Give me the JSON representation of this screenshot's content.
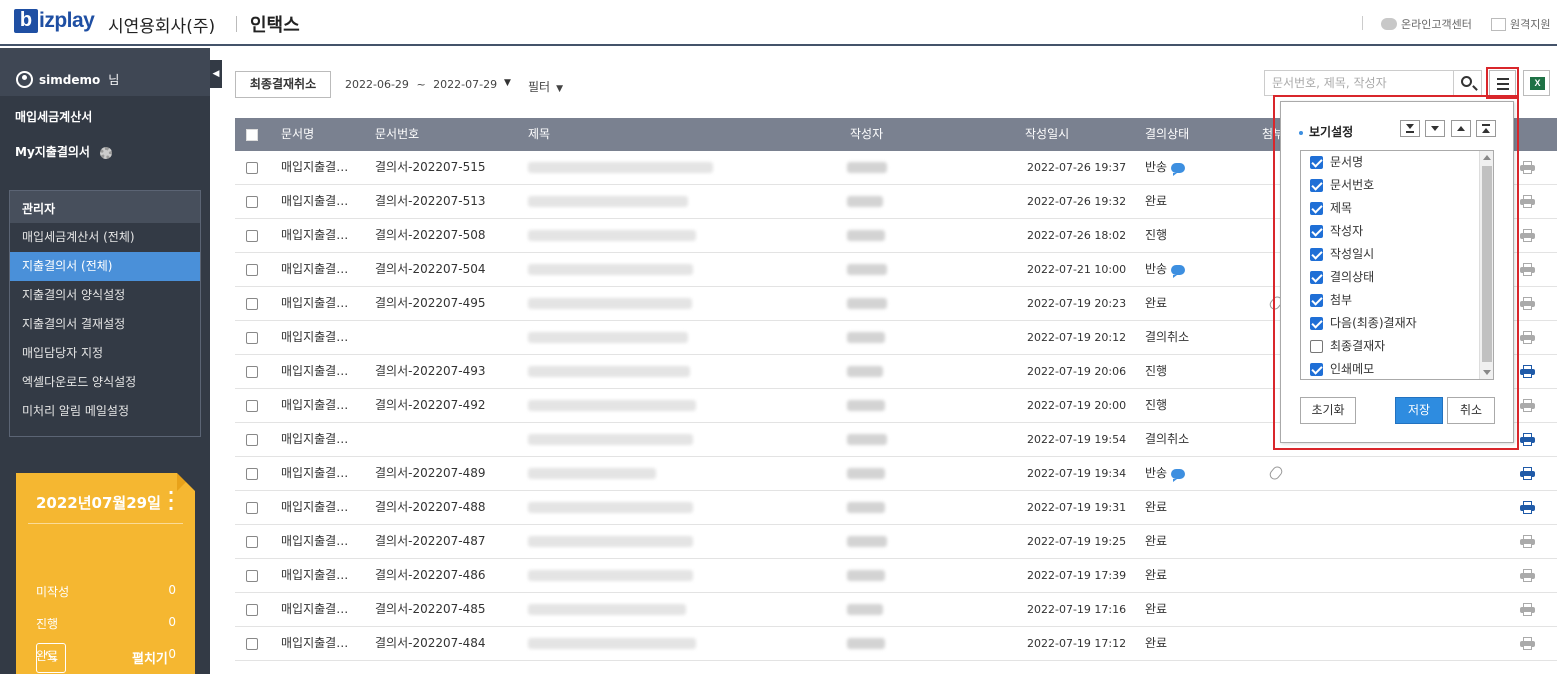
{
  "header": {
    "logo_letter": "b",
    "logo_rest": "izplay",
    "company": "시연용회사(주)",
    "product": "인택스",
    "links": [
      {
        "label": "온라인고객센터",
        "icon": "chat-bubbles-icon"
      },
      {
        "label": "원격지원",
        "icon": "remote-support-icon"
      }
    ]
  },
  "sidebar": {
    "user": "simdemo",
    "user_suffix": "님",
    "menu": [
      {
        "label": "매입세금계산서"
      },
      {
        "label": "My지출결의서",
        "icon": "gear-icon"
      }
    ],
    "admin_header": "관리자",
    "admin_items": [
      {
        "label": "매입세금계산서 (전체)",
        "active": false
      },
      {
        "label": "지출결의서 (전체)",
        "active": true
      },
      {
        "label": "지출결의서 양식설정",
        "active": false
      },
      {
        "label": "지출결의서 결재설정",
        "active": false
      },
      {
        "label": "매입담당자 지정",
        "active": false
      },
      {
        "label": "엑셀다운로드 양식설정",
        "active": false
      },
      {
        "label": "미처리 알림 메일설정",
        "active": false
      }
    ],
    "date_card": {
      "title": "2022년07월29일",
      "stats": [
        {
          "label": "미작성",
          "value": "0"
        },
        {
          "label": "진행",
          "value": "0"
        },
        {
          "label": "완료",
          "value": "0"
        }
      ],
      "expand_label": "펼치기",
      "color": "#f5b731"
    }
  },
  "toolbar": {
    "final_cancel": "최종결재취소",
    "date_from": "2022-06-29",
    "tilde": "~",
    "date_to": "2022-07-29",
    "filter_label": "필터",
    "search_placeholder": "문서번호, 제목, 작성자"
  },
  "table": {
    "headers": [
      "문서명",
      "문서번호",
      "제목",
      "작성자",
      "작성일시",
      "결의상태",
      "첨부"
    ],
    "rows": [
      {
        "doc": "매입지출결…",
        "no": "결의서-202207-515",
        "date": "2022-07-26 19:37",
        "status": "반송",
        "comment": true,
        "attach": false,
        "print_active": false
      },
      {
        "doc": "매입지출결…",
        "no": "결의서-202207-513",
        "date": "2022-07-26 19:32",
        "status": "완료",
        "comment": false,
        "attach": false,
        "print_active": false
      },
      {
        "doc": "매입지출결…",
        "no": "결의서-202207-508",
        "date": "2022-07-26 18:02",
        "status": "진행",
        "comment": false,
        "attach": false,
        "print_active": false
      },
      {
        "doc": "매입지출결…",
        "no": "결의서-202207-504",
        "date": "2022-07-21 10:00",
        "status": "반송",
        "comment": true,
        "attach": false,
        "print_active": false
      },
      {
        "doc": "매입지출결…",
        "no": "결의서-202207-495",
        "date": "2022-07-19 20:23",
        "status": "완료",
        "comment": false,
        "attach": true,
        "print_active": false
      },
      {
        "doc": "매입지출결…",
        "no": "",
        "date": "2022-07-19 20:12",
        "status": "결의취소",
        "comment": false,
        "attach": false,
        "print_active": false
      },
      {
        "doc": "매입지출결…",
        "no": "결의서-202207-493",
        "date": "2022-07-19 20:06",
        "status": "진행",
        "comment": false,
        "attach": false,
        "print_active": true
      },
      {
        "doc": "매입지출결…",
        "no": "결의서-202207-492",
        "date": "2022-07-19 20:00",
        "status": "진행",
        "comment": false,
        "attach": false,
        "print_active": false
      },
      {
        "doc": "매입지출결…",
        "no": "",
        "date": "2022-07-19 19:54",
        "status": "결의취소",
        "comment": false,
        "attach": false,
        "print_active": true
      },
      {
        "doc": "매입지출결…",
        "no": "결의서-202207-489",
        "date": "2022-07-19 19:34",
        "status": "반송",
        "comment": true,
        "attach": true,
        "print_active": true
      },
      {
        "doc": "매입지출결…",
        "no": "결의서-202207-488",
        "date": "2022-07-19 19:31",
        "status": "완료",
        "comment": false,
        "attach": false,
        "print_active": true
      },
      {
        "doc": "매입지출결…",
        "no": "결의서-202207-487",
        "date": "2022-07-19 19:25",
        "status": "완료",
        "comment": false,
        "attach": false,
        "print_active": false
      },
      {
        "doc": "매입지출결…",
        "no": "결의서-202207-486",
        "date": "2022-07-19 17:39",
        "status": "완료",
        "comment": false,
        "attach": false,
        "print_active": false
      },
      {
        "doc": "매입지출결…",
        "no": "결의서-202207-485",
        "date": "2022-07-19 17:16",
        "status": "완료",
        "comment": false,
        "attach": false,
        "print_active": false
      },
      {
        "doc": "매입지출결…",
        "no": "결의서-202207-484",
        "date": "2022-07-19 17:12",
        "status": "완료",
        "comment": false,
        "attach": false,
        "print_active": false
      }
    ]
  },
  "view_settings": {
    "title": "보기설정",
    "columns": [
      {
        "label": "문서명",
        "checked": true
      },
      {
        "label": "문서번호",
        "checked": true
      },
      {
        "label": "제목",
        "checked": true
      },
      {
        "label": "작성자",
        "checked": true
      },
      {
        "label": "작성일시",
        "checked": true
      },
      {
        "label": "결의상태",
        "checked": true
      },
      {
        "label": "첨부",
        "checked": true
      },
      {
        "label": "다음(최종)결재자",
        "checked": true
      },
      {
        "label": "최종결재자",
        "checked": false
      },
      {
        "label": "인쇄메모",
        "checked": true
      }
    ],
    "reset": "초기화",
    "save": "저장",
    "cancel": "취소"
  },
  "colors": {
    "brand": "#1f4fa3",
    "sidebar": "#333a45",
    "header_row": "#7a8190",
    "active_item": "#4a90d9",
    "highlight": "#d9262b",
    "comment": "#3d8fe0"
  }
}
